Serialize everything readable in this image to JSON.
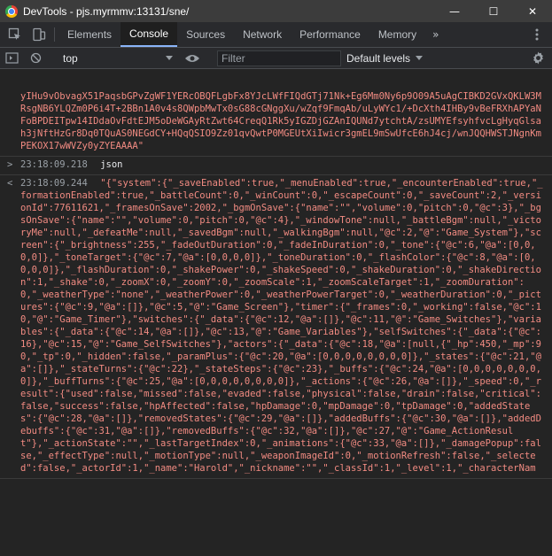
{
  "window": {
    "title": "DevTools - pjs.myrmmv:13131/sne/",
    "minimize": "—",
    "maximize": "☐",
    "close": "✕"
  },
  "tabs": [
    "Elements",
    "Console",
    "Sources",
    "Network",
    "Performance",
    "Memory"
  ],
  "active_tab": "Console",
  "more_tabs": "»",
  "console_toolbar": {
    "context": "top",
    "filter_placeholder": "Filter",
    "levels": "Default levels"
  },
  "messages": [
    {
      "kind": "result",
      "text": "yIHu9vObvagX51PaqsbGPvZgWF1YERcOBQFLgbFx8YJcLWfFIQdGTj71Nk+Eg6Mm0Ny6p9O09A5uAgCIBKD2GVxQKLW3MRsgNB6YLQZm0P6i4T+2BBn1A0v4s8QWpbMwTx0sG88cGNggXu/wZqf9FmqAb/uLyWYc1/+DcXth4IHBy9vBeFRXhAPYaNFoBPDEITpw14IDdaOvFdtEJM5oDeWGAyRtZwt64CreqQ1Rk5yIGZDjGZAnIQUNd7ytchtA/zsUMYEfsyhfvcLgHyqGlsah3jNftHzGr8Dq0TQuAS0NEGdCY+HQqQSIO9Zz01qvQwtP0MGEUtXiIwicr3gmEL9mSwUfcE6hJ4cj/wnJQQHWSTJNgnKmPEKOX17wWVZy0yZYEAAAA\""
    },
    {
      "kind": "command",
      "timestamp": "23:18:09.218",
      "text": "json"
    },
    {
      "kind": "result",
      "timestamp": "23:18:09.244",
      "text": "\"{\"system\":{\"_saveEnabled\":true,\"_menuEnabled\":true,\"_encounterEnabled\":true,\"_formationEnabled\":true,\"_battleCount\":0,\"_winCount\":0,\"_escapeCount\":0,\"_saveCount\":2,\"_versionId\":77611621,\"_framesOnSave\":2002,\"_bgmOnSave\":{\"name\":\"\",\"volume\":0,\"pitch\":0,\"@c\":3},\"_bgsOnSave\":{\"name\":\"\",\"volume\":0,\"pitch\":0,\"@c\":4},\"_windowTone\":null,\"_battleBgm\":null,\"_victoryMe\":null,\"_defeatMe\":null,\"_savedBgm\":null,\"_walkingBgm\":null,\"@c\":2,\"@\":\"Game_System\"},\"screen\":{\"_brightness\":255,\"_fadeOutDuration\":0,\"_fadeInDuration\":0,\"_tone\":{\"@c\":6,\"@a\":[0,0,0,0]},\"_toneTarget\":{\"@c\":7,\"@a\":[0,0,0,0]},\"_toneDuration\":0,\"_flashColor\":{\"@c\":8,\"@a\":[0,0,0,0]},\"_flashDuration\":0,\"_shakePower\":0,\"_shakeSpeed\":0,\"_shakeDuration\":0,\"_shakeDirection\":1,\"_shake\":0,\"_zoomX\":0,\"_zoomY\":0,\"_zoomScale\":1,\"_zoomScaleTarget\":1,\"_zoomDuration\":0,\"_weatherType\":\"none\",\"_weatherPower\":0,\"_weatherPowerTarget\":0,\"_weatherDuration\":0,\"_pictures\":{\"@c\":9,\"@a\":[]},\"@c\":5,\"@\":\"Game_Screen\"},\"timer\":{\"_frames\":0,\"_working\":false,\"@c\":10,\"@\":\"Game_Timer\"},\"switches\":{\"_data\":{\"@c\":12,\"@a\":[]},\"@c\":11,\"@\":\"Game_Switches\"},\"variables\":{\"_data\":{\"@c\":14,\"@a\":[]},\"@c\":13,\"@\":\"Game_Variables\"},\"selfSwitches\":{\"_data\":{\"@c\":16},\"@c\":15,\"@\":\"Game_SelfSwitches\"},\"actors\":{\"_data\":{\"@c\":18,\"@a\":[null,{\"_hp\":450,\"_mp\":90,\"_tp\":0,\"_hidden\":false,\"_paramPlus\":{\"@c\":20,\"@a\":[0,0,0,0,0,0,0,0]},\"_states\":{\"@c\":21,\"@a\":[]},\"_stateTurns\":{\"@c\":22},\"_stateSteps\":{\"@c\":23},\"_buffs\":{\"@c\":24,\"@a\":[0,0,0,0,0,0,0,0]},\"_buffTurns\":{\"@c\":25,\"@a\":[0,0,0,0,0,0,0,0]},\"_actions\":{\"@c\":26,\"@a\":[]},\"_speed\":0,\"_result\":{\"used\":false,\"missed\":false,\"evaded\":false,\"physical\":false,\"drain\":false,\"critical\":false,\"success\":false,\"hpAffected\":false,\"hpDamage\":0,\"mpDamage\":0,\"tpDamage\":0,\"addedStates\":{\"@c\":28,\"@a\":[]},\"removedStates\":{\"@c\":29,\"@a\":[]},\"addedBuffs\":{\"@c\":30,\"@a\":[]},\"addedDebuffs\":{\"@c\":31,\"@a\":[]},\"removedBuffs\":{\"@c\":32,\"@a\":[]},\"@c\":27,\"@\":\"Game_ActionResult\"},\"_actionState\":\"\",\"_lastTargetIndex\":0,\"_animations\":{\"@c\":33,\"@a\":[]},\"_damagePopup\":false,\"_effectType\":null,\"_motionType\":null,\"_weaponImageId\":0,\"_motionRefresh\":false,\"_selected\":false,\"_actorId\":1,\"_name\":\"Harold\",\"_nickname\":\"\",\"_classId\":1,\"_level\":1,\"_characterNam"
    }
  ]
}
